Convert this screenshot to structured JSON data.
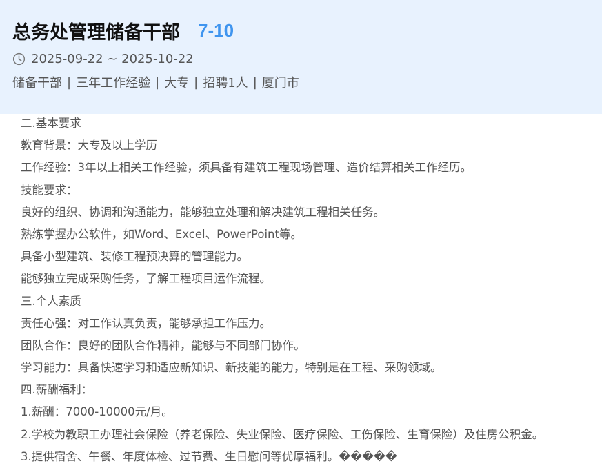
{
  "job": {
    "title": "总务处管理储备干部",
    "salary": "7-10",
    "date_range": "2025-09-22 ~ 2025-10-22",
    "clock_icon": "clock-icon",
    "tags": [
      "储备干部",
      "三年工作经验",
      "大专",
      "招聘1人",
      "厦门市"
    ],
    "tag_separator": "|"
  },
  "description": {
    "lines": [
      "二.基本要求",
      "教育背景：大专及以上学历",
      "工作经验：3年以上相关工作经验，须具备有建筑工程现场管理、造价结算相关工作经历。",
      "技能要求：",
      "良好的组织、协调和沟通能力，能够独立处理和解决建筑工程相关任务。",
      "熟练掌握办公软件，如Word、Excel、PowerPoint等。",
      "具备小型建筑、装修工程预决算的管理能力。",
      "能够独立完成采购任务，了解工程项目运作流程。",
      "三.个人素质",
      "责任心强：对工作认真负责，能够承担工作压力。",
      "团队合作：良好的团队合作精神，能够与不同部门协作。",
      "学习能力：具备快速学习和适应新知识、新技能的能力，特别是在工程、采购领域。",
      "四.薪酬福利：",
      "1.薪酬：7000-10000元/月。",
      "2.学校为教职工办理社会保险（养老保险、失业保险、医疗保险、工伤保险、生育保险）及住房公积金。",
      "3.提供宿舍、午餐、年度体检、过节费、生日慰问等优厚福利。�����"
    ]
  },
  "colors": {
    "header_bg": "#e8f2fe",
    "salary": "#3f95ef",
    "title": "#111111",
    "body_text": "#555555"
  }
}
